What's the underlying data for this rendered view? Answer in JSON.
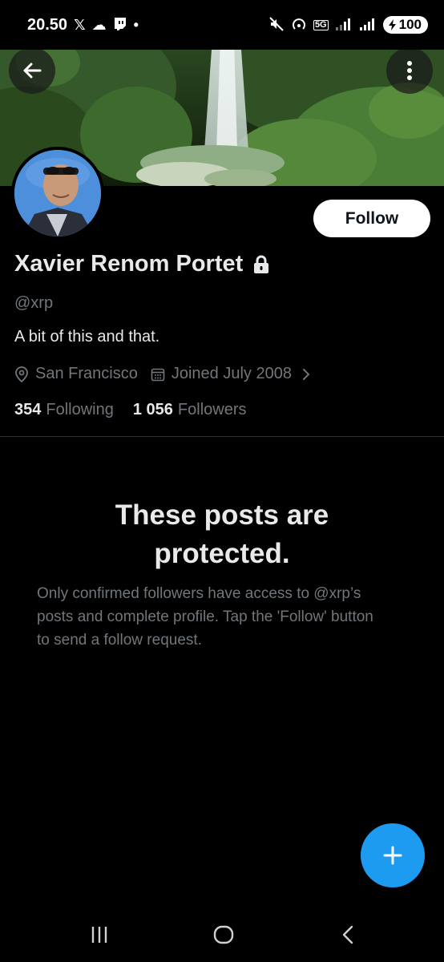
{
  "status_bar": {
    "time": "20.50",
    "battery": "100",
    "network": "5G"
  },
  "header": {
    "back_icon": "arrow-left-icon",
    "more_icon": "more-vertical-icon"
  },
  "profile": {
    "display_name": "Xavier Renom Portet",
    "locked_icon": "lock-icon",
    "handle": "@xrp",
    "bio": "A bit of this and that.",
    "location": "San Francisco",
    "joined": "Joined July 2008",
    "following_count": "354",
    "following_label": "Following",
    "followers_count": "1 056",
    "followers_label": "Followers",
    "follow_button": "Follow"
  },
  "protected_notice": {
    "title": "These posts are protected.",
    "body": "Only confirmed followers have access to @xrp’s posts and complete profile. Tap the 'Follow' button to send a follow request."
  },
  "fab": {
    "icon": "plus-icon"
  },
  "colors": {
    "background": "#000000",
    "primary_text": "#e7e9ea",
    "secondary_text": "#71767b",
    "accent": "#1d9bf0",
    "divider": "#2f3336"
  }
}
